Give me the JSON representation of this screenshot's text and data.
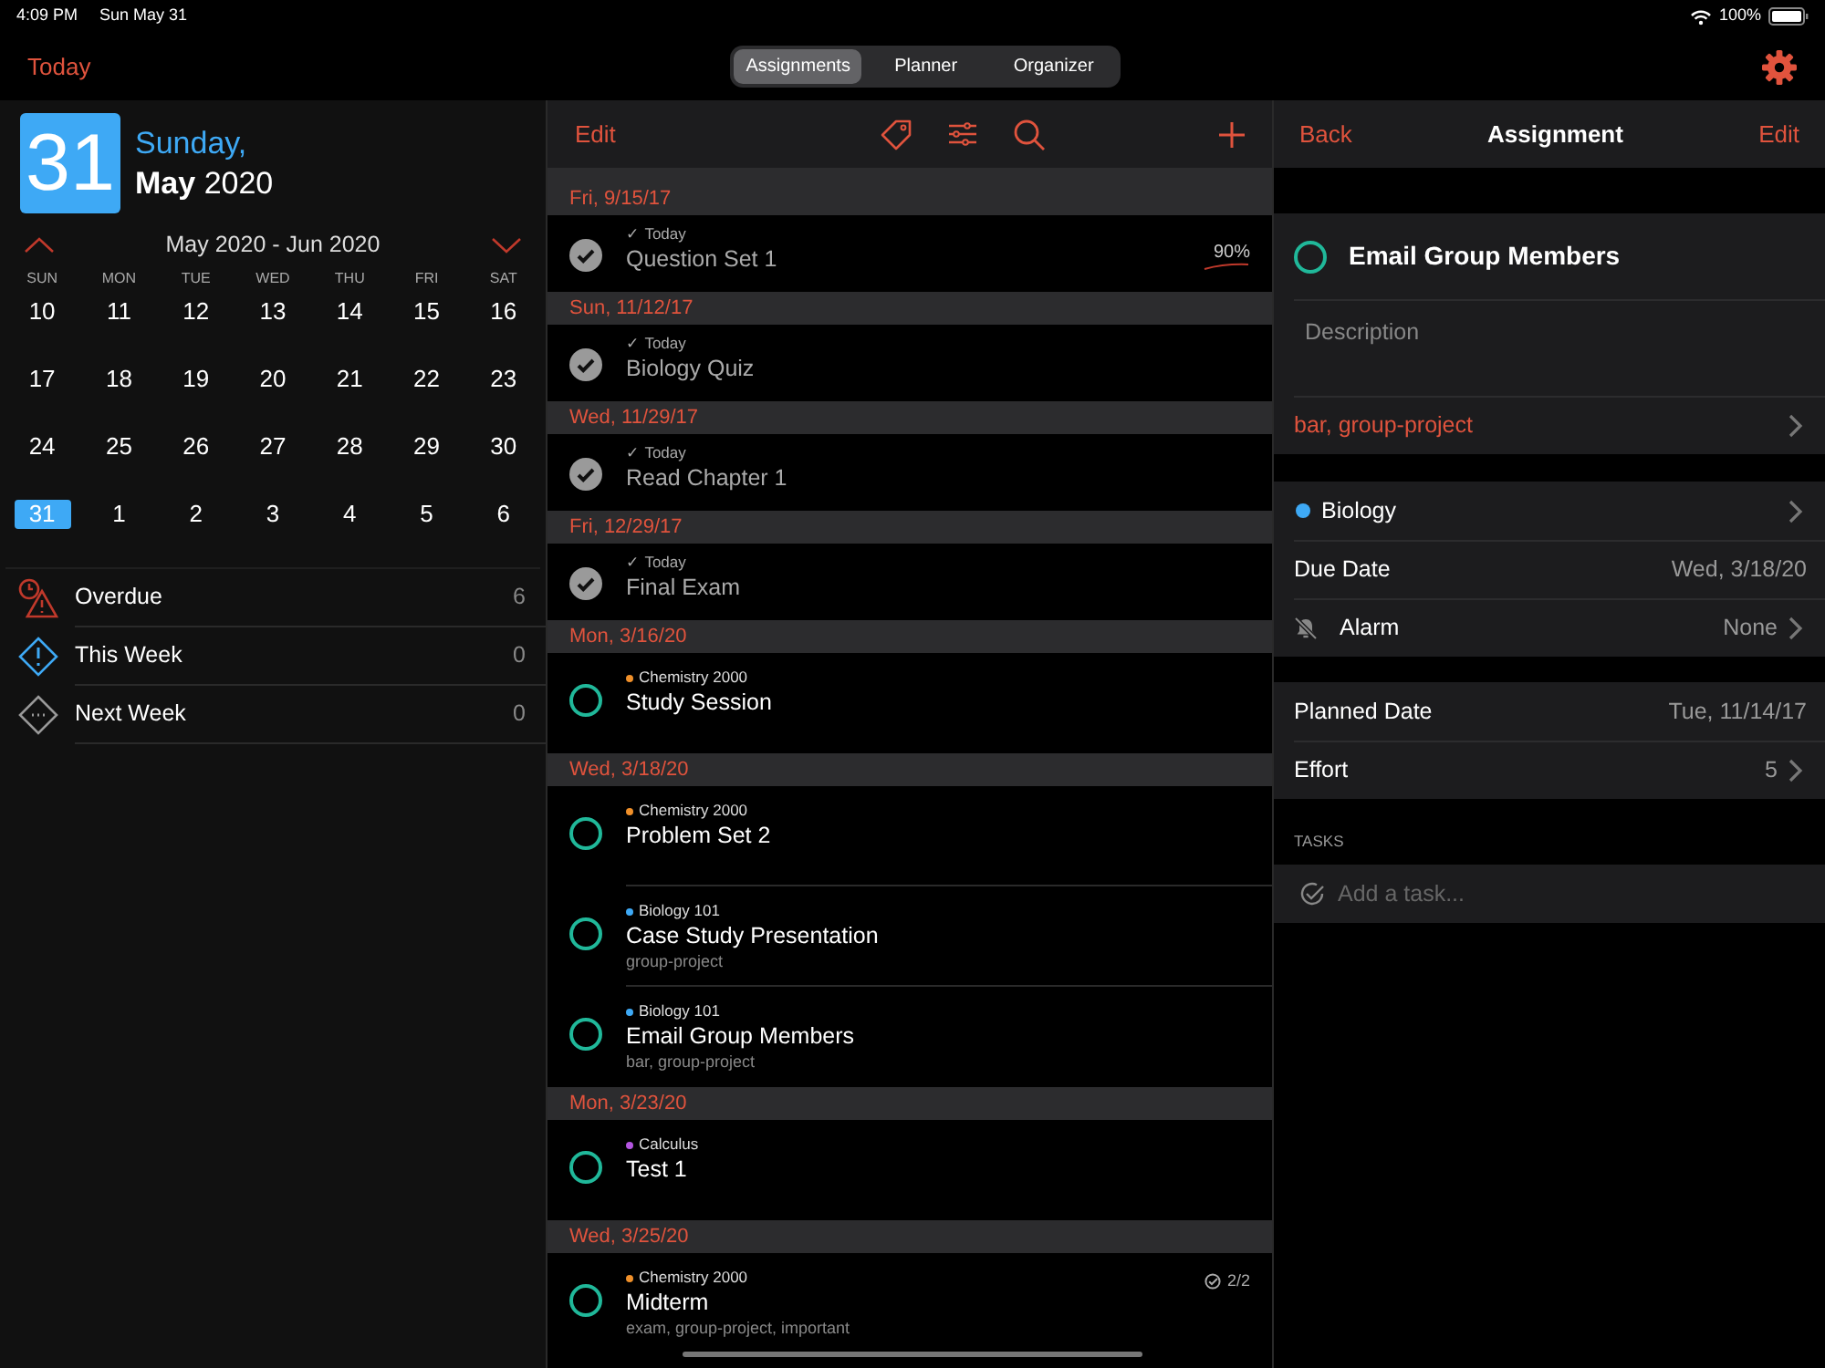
{
  "status_bar": {
    "time": "4:09 PM",
    "date": "Sun May 31",
    "battery": "100%"
  },
  "top_bar": {
    "today": "Today",
    "segments": [
      {
        "label": "Assignments",
        "selected": true
      },
      {
        "label": "Planner",
        "selected": false
      },
      {
        "label": "Organizer",
        "selected": false
      }
    ]
  },
  "sidebar": {
    "day_number": "31",
    "weekday": "Sunday,",
    "month": "May",
    "year": "2020",
    "range": "May 2020 - Jun 2020",
    "weekdays": [
      "SUN",
      "MON",
      "TUE",
      "WED",
      "THU",
      "FRI",
      "SAT"
    ],
    "weeks": [
      [
        {
          "day": "10",
          "selected": false
        },
        {
          "day": "11",
          "selected": false
        },
        {
          "day": "12",
          "selected": false
        },
        {
          "day": "13",
          "selected": false
        },
        {
          "day": "14",
          "selected": false
        },
        {
          "day": "15",
          "selected": false
        },
        {
          "day": "16",
          "selected": false
        }
      ],
      [
        {
          "day": "17",
          "selected": false
        },
        {
          "day": "18",
          "selected": false
        },
        {
          "day": "19",
          "selected": false
        },
        {
          "day": "20",
          "selected": false
        },
        {
          "day": "21",
          "selected": false
        },
        {
          "day": "22",
          "selected": false
        },
        {
          "day": "23",
          "selected": false
        }
      ],
      [
        {
          "day": "24",
          "selected": false
        },
        {
          "day": "25",
          "selected": false
        },
        {
          "day": "26",
          "selected": false
        },
        {
          "day": "27",
          "selected": false
        },
        {
          "day": "28",
          "selected": false
        },
        {
          "day": "29",
          "selected": false
        },
        {
          "day": "30",
          "selected": false
        }
      ],
      [
        {
          "day": "31",
          "selected": true
        },
        {
          "day": "1",
          "selected": false
        },
        {
          "day": "2",
          "selected": false
        },
        {
          "day": "3",
          "selected": false
        },
        {
          "day": "4",
          "selected": false
        },
        {
          "day": "5",
          "selected": false
        },
        {
          "day": "6",
          "selected": false
        }
      ]
    ],
    "filters": [
      {
        "kind": "overdue",
        "label": "Overdue",
        "count": "6"
      },
      {
        "kind": "this_week",
        "label": "This Week",
        "count": "0"
      },
      {
        "kind": "next_week",
        "label": "Next Week",
        "count": "0"
      }
    ]
  },
  "list": {
    "edit": "Edit",
    "sections": [
      {
        "date": "Fri, 9/15/17",
        "items": [
          {
            "title": "Question Set 1",
            "done": true,
            "note": "✓ Today",
            "grade": "90%"
          }
        ]
      },
      {
        "date": "Sun, 11/12/17",
        "items": [
          {
            "title": "Biology Quiz",
            "done": true,
            "note": "✓ Today"
          }
        ]
      },
      {
        "date": "Wed, 11/29/17",
        "items": [
          {
            "title": "Read Chapter 1",
            "done": true,
            "note": "✓ Today"
          }
        ]
      },
      {
        "date": "Fri, 12/29/17",
        "items": [
          {
            "title": "Final Exam",
            "done": true,
            "note": "✓ Today"
          }
        ]
      },
      {
        "date": "Mon, 3/16/20",
        "items": [
          {
            "title": "Study Session",
            "done": false,
            "course": "Chemistry 2000",
            "color": "#f0902a"
          }
        ]
      },
      {
        "date": "Wed, 3/18/20",
        "items": [
          {
            "title": "Problem Set 2",
            "done": false,
            "course": "Chemistry 2000",
            "color": "#f0902a"
          },
          {
            "title": "Case Study Presentation",
            "done": false,
            "course": "Biology 101",
            "color": "#3ea9f5",
            "tags": "group-project"
          },
          {
            "title": "Email Group Members",
            "done": false,
            "course": "Biology 101",
            "color": "#3ea9f5",
            "tags": "bar, group-project"
          }
        ]
      },
      {
        "date": "Mon, 3/23/20",
        "items": [
          {
            "title": "Test 1",
            "done": false,
            "course": "Calculus",
            "color": "#b455e0"
          }
        ]
      },
      {
        "date": "Wed, 3/25/20",
        "items": [
          {
            "title": "Midterm",
            "done": false,
            "course": "Chemistry 2000",
            "color": "#f0902a",
            "tags": "exam, group-project, important",
            "tasks": "2/2"
          }
        ]
      }
    ]
  },
  "detail": {
    "back": "Back",
    "title": "Assignment",
    "edit": "Edit",
    "name": "Email Group Members",
    "done": false,
    "description_placeholder": "Description",
    "tags": "bar, group-project",
    "course": {
      "name": "Biology",
      "color": "#3ea9f5"
    },
    "due_label": "Due Date",
    "due_value": "Wed, 3/18/20",
    "alarm_label": "Alarm",
    "alarm_value": "None",
    "planned_label": "Planned Date",
    "planned_value": "Tue, 11/14/17",
    "effort_label": "Effort",
    "effort_value": "5",
    "tasks_header": "TASKS",
    "task_placeholder": "Add a task..."
  }
}
